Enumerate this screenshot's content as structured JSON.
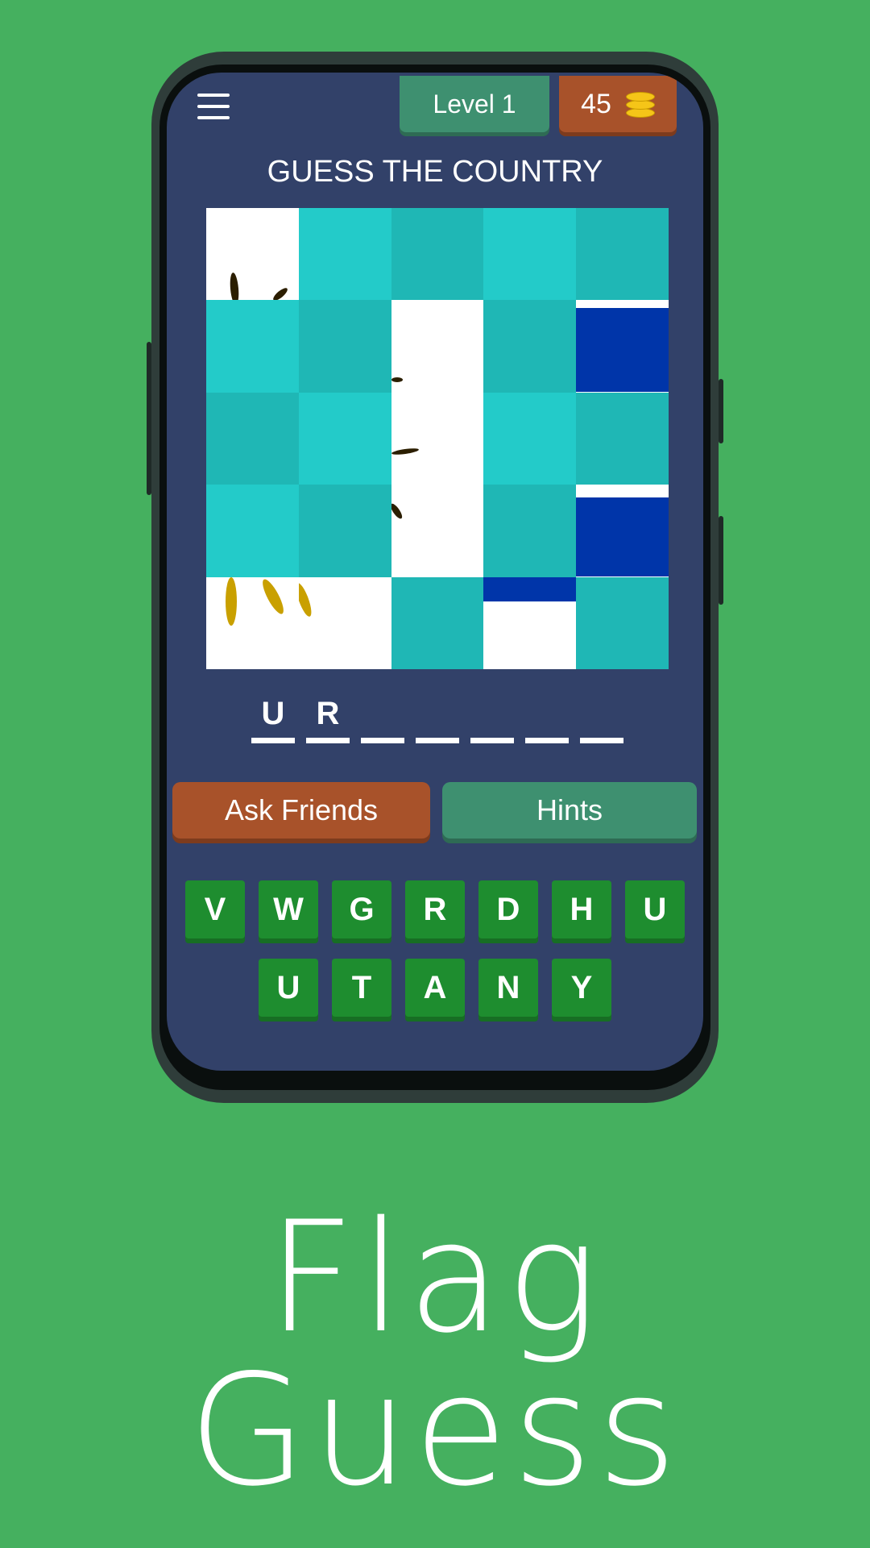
{
  "header": {
    "level_label": "Level 1",
    "coins": "45"
  },
  "title": "GUESS THE COUNTRY",
  "puzzle": {
    "rows": 5,
    "cols": 5
  },
  "answer_slots": [
    "U",
    "R",
    "",
    "",
    "",
    "",
    ""
  ],
  "buttons": {
    "ask_friends": "Ask Friends",
    "hints": "Hints"
  },
  "letter_rows": [
    [
      "V",
      "W",
      "G",
      "R",
      "D",
      "H",
      "U"
    ],
    [
      "U",
      "T",
      "A",
      "N",
      "Y"
    ]
  ],
  "brand": "Flag Guess",
  "colors": {
    "background": "#45b05f",
    "screen": "#324169",
    "level_badge": "#3e9070",
    "coin_badge": "#a8522a",
    "letter_key": "#1e8d2f"
  }
}
